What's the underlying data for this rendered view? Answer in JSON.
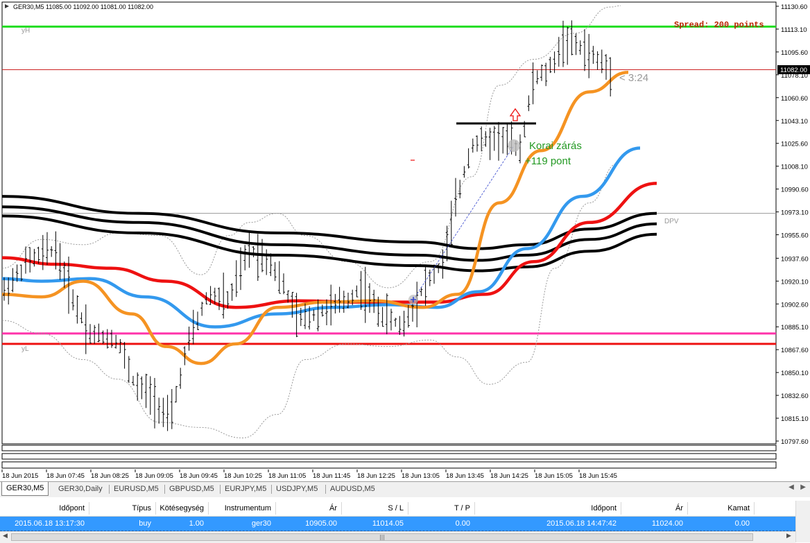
{
  "chart": {
    "info_line": "GER30,M5  11085.00 11092.00 11081.00 11082.00",
    "spread_text": "Spread: 200 points",
    "countdown": "< 3:24",
    "current_price": "11082.00",
    "annotation_line1": "Korai zárás",
    "annotation_line2": "+119 pont",
    "label_yH": "yH",
    "label_yL": "yL",
    "label_DPV": "DPV",
    "price_axis": [
      "11130.60",
      "11113.10",
      "11095.60",
      "11078.10",
      "11060.60",
      "11043.10",
      "11025.60",
      "11008.10",
      "10990.60",
      "10973.10",
      "10955.60",
      "10937.60",
      "10920.10",
      "10902.60",
      "10885.10",
      "10867.60",
      "10850.10",
      "10832.60",
      "10815.10",
      "10797.60"
    ],
    "time_axis": [
      "18 Jun 2015",
      "18 Jun 07:45",
      "18 Jun 08:25",
      "18 Jun 09:05",
      "18 Jun 09:45",
      "18 Jun 10:25",
      "18 Jun 11:05",
      "18 Jun 11:45",
      "18 Jun 12:25",
      "18 Jun 13:05",
      "18 Jun 13:45",
      "18 Jun 14:25",
      "18 Jun 15:05",
      "18 Jun 15:45"
    ],
    "levels": {
      "green_line": 11115.0,
      "dark_red_line": 11082.0,
      "gray_line": 10972.0,
      "pink_line": 10880.0,
      "red_line": 10872.0
    },
    "colors": {
      "green": "#22dd22",
      "pink": "#ff33aa",
      "red": "#ee1111",
      "orange": "#f59322",
      "blue": "#3399ee",
      "black": "#000000",
      "annotation": "#229922",
      "spread": "#bb2200"
    }
  },
  "tabs": [
    {
      "label": "GER30,M5",
      "active": true
    },
    {
      "label": "GER30,Daily",
      "active": false
    },
    {
      "label": "EURUSD,M5",
      "active": false
    },
    {
      "label": "GBPUSD,M5",
      "active": false
    },
    {
      "label": "EURJPY,M5",
      "active": false
    },
    {
      "label": "USDJPY,M5",
      "active": false
    },
    {
      "label": "AUDUSD,M5",
      "active": false
    }
  ],
  "table": {
    "headers": [
      "Időpont",
      "Típus",
      "Kötésegység",
      "Instrumentum",
      "Ár",
      "S / L",
      "T / P",
      "Időpont",
      "Ár",
      "Kamat"
    ],
    "row": [
      "2015.06.18 13:17:30",
      "buy",
      "1.00",
      "ger30",
      "10905.00",
      "11014.05",
      "0.00",
      "2015.06.18 14:47:42",
      "11024.00",
      "0.00"
    ]
  }
}
